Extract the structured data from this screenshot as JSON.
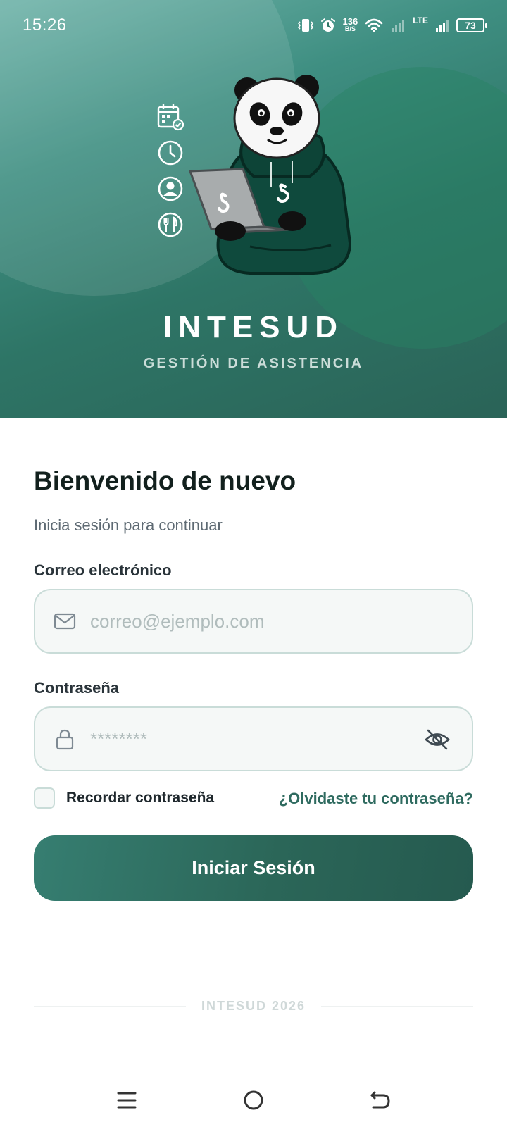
{
  "status_bar": {
    "time": "15:26",
    "net_speed": "136",
    "net_speed_unit": "B/S",
    "network_type": "LTE",
    "battery": "73"
  },
  "hero": {
    "title": "INTESUD",
    "subtitle": "GESTIÓN DE ASISTENCIA",
    "feature_icons": [
      "calendar-check-icon",
      "clock-icon",
      "user-icon",
      "utensils-icon"
    ],
    "colors": {
      "gradient_start": "#6fb3a9",
      "gradient_end": "#2a6357"
    }
  },
  "login": {
    "title": "Bienvenido de nuevo",
    "subtitle": "Inicia sesión para continuar",
    "email": {
      "label": "Correo electrónico",
      "placeholder": "correo@ejemplo.com",
      "value": ""
    },
    "password": {
      "label": "Contraseña",
      "placeholder": "********",
      "value": ""
    },
    "remember_label": "Recordar contraseña",
    "remember_checked": false,
    "forgot_label": "¿Olvidaste tu contraseña?",
    "submit_label": "Iniciar Sesión",
    "accent_color": "#2f6b60"
  },
  "footer": {
    "text": "INTESUD 2026"
  },
  "nav_bar": {
    "buttons": [
      "menu-icon",
      "home-icon",
      "back-icon"
    ]
  }
}
